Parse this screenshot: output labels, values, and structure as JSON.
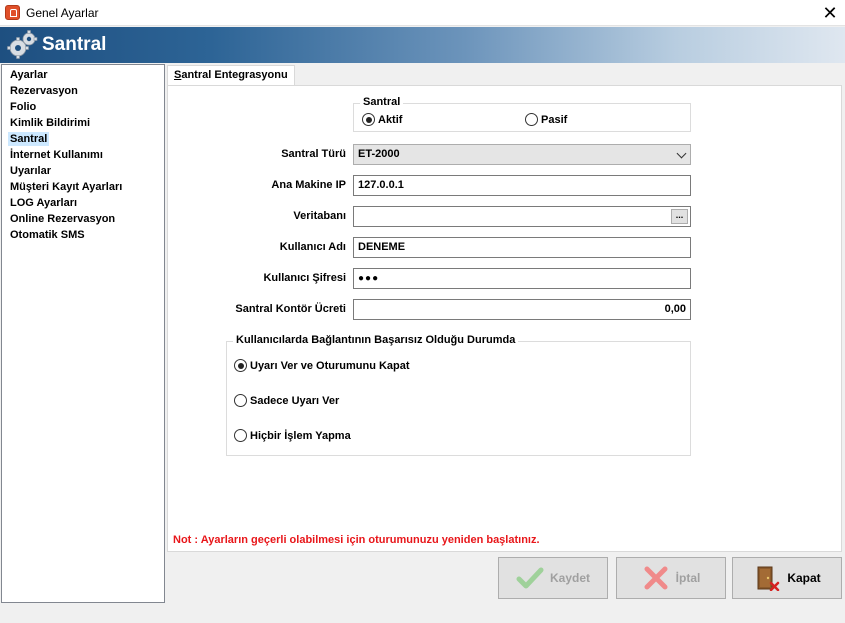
{
  "window": {
    "title": "Genel Ayarlar",
    "close_glyph": "✕"
  },
  "banner": {
    "title": "Santral",
    "icon": "gears-icon"
  },
  "sidebar": {
    "items": [
      {
        "label": "Ayarlar"
      },
      {
        "label": "Rezervasyon"
      },
      {
        "label": "Folio"
      },
      {
        "label": "Kimlik Bildirimi"
      },
      {
        "label": "Santral",
        "selected": true
      },
      {
        "label": "İnternet Kullanımı"
      },
      {
        "label": "Uyarılar"
      },
      {
        "label": "Müşteri Kayıt Ayarları"
      },
      {
        "label": "LOG Ayarları"
      },
      {
        "label": "Online Rezervasyon"
      },
      {
        "label": "Otomatik SMS"
      }
    ]
  },
  "tab": {
    "first_letter": "S",
    "rest": "antral Entegrasyonu"
  },
  "santral_group": {
    "legend": "Santral",
    "options": [
      {
        "label": "Aktif",
        "checked": true
      },
      {
        "label": "Pasif",
        "checked": false
      }
    ]
  },
  "fields": {
    "santral_turu": {
      "label": "Santral Türü",
      "value": "ET-2000"
    },
    "ana_makine_ip": {
      "label": "Ana Makine IP",
      "value": "127.0.0.1"
    },
    "veritabani": {
      "label": "Veritabanı",
      "value": "",
      "button": "..."
    },
    "kullanici_adi": {
      "label": "Kullanıcı Adı",
      "value": "DENEME"
    },
    "kullanici_sifresi": {
      "label": "Kullanıcı Şifresi",
      "value": "●●●"
    },
    "kontor_ucreti": {
      "label": "Santral Kontör Ücreti",
      "value": "0,00"
    }
  },
  "failure_group": {
    "legend": "Kullanıcılarda Bağlantının Başarısız Olduğu Durumda",
    "options": [
      {
        "label": "Uyarı Ver ve Oturumunu Kapat",
        "checked": true
      },
      {
        "label": "Sadece Uyarı Ver",
        "checked": false
      },
      {
        "label": "Hiçbir İşlem Yapma",
        "checked": false
      }
    ]
  },
  "note": "Not : Ayarların geçerli olabilmesi için oturumunuzu yeniden başlatınız.",
  "buttons": {
    "save": {
      "label": "Kaydet",
      "enabled": false
    },
    "cancel": {
      "label": "İptal",
      "enabled": false
    },
    "close": {
      "label": "Kapat",
      "enabled": true
    }
  },
  "colors": {
    "note": "#e8161a",
    "selected_item": "#cce8ff",
    "banner_dark": "#1e4f80"
  }
}
